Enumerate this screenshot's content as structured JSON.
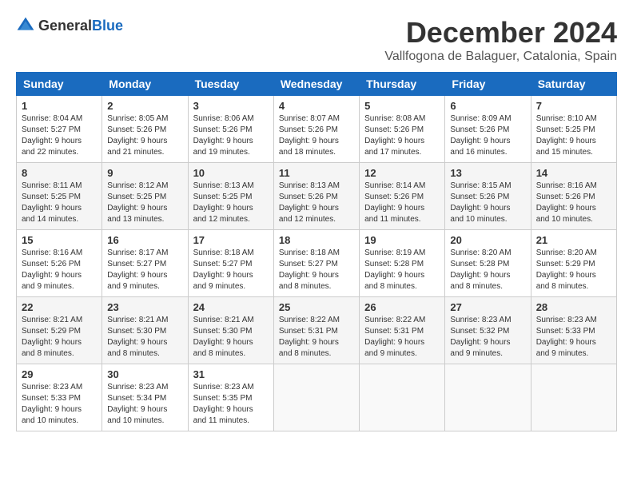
{
  "header": {
    "logo_general": "General",
    "logo_blue": "Blue",
    "month_title": "December 2024",
    "location": "Vallfogona de Balaguer, Catalonia, Spain"
  },
  "weekdays": [
    "Sunday",
    "Monday",
    "Tuesday",
    "Wednesday",
    "Thursday",
    "Friday",
    "Saturday"
  ],
  "weeks": [
    [
      {
        "day": "1",
        "sunrise": "8:04 AM",
        "sunset": "5:27 PM",
        "daylight": "9 hours and 22 minutes."
      },
      {
        "day": "2",
        "sunrise": "8:05 AM",
        "sunset": "5:26 PM",
        "daylight": "9 hours and 21 minutes."
      },
      {
        "day": "3",
        "sunrise": "8:06 AM",
        "sunset": "5:26 PM",
        "daylight": "9 hours and 19 minutes."
      },
      {
        "day": "4",
        "sunrise": "8:07 AM",
        "sunset": "5:26 PM",
        "daylight": "9 hours and 18 minutes."
      },
      {
        "day": "5",
        "sunrise": "8:08 AM",
        "sunset": "5:26 PM",
        "daylight": "9 hours and 17 minutes."
      },
      {
        "day": "6",
        "sunrise": "8:09 AM",
        "sunset": "5:26 PM",
        "daylight": "9 hours and 16 minutes."
      },
      {
        "day": "7",
        "sunrise": "8:10 AM",
        "sunset": "5:25 PM",
        "daylight": "9 hours and 15 minutes."
      }
    ],
    [
      {
        "day": "8",
        "sunrise": "8:11 AM",
        "sunset": "5:25 PM",
        "daylight": "9 hours and 14 minutes."
      },
      {
        "day": "9",
        "sunrise": "8:12 AM",
        "sunset": "5:25 PM",
        "daylight": "9 hours and 13 minutes."
      },
      {
        "day": "10",
        "sunrise": "8:13 AM",
        "sunset": "5:25 PM",
        "daylight": "9 hours and 12 minutes."
      },
      {
        "day": "11",
        "sunrise": "8:13 AM",
        "sunset": "5:26 PM",
        "daylight": "9 hours and 12 minutes."
      },
      {
        "day": "12",
        "sunrise": "8:14 AM",
        "sunset": "5:26 PM",
        "daylight": "9 hours and 11 minutes."
      },
      {
        "day": "13",
        "sunrise": "8:15 AM",
        "sunset": "5:26 PM",
        "daylight": "9 hours and 10 minutes."
      },
      {
        "day": "14",
        "sunrise": "8:16 AM",
        "sunset": "5:26 PM",
        "daylight": "9 hours and 10 minutes."
      }
    ],
    [
      {
        "day": "15",
        "sunrise": "8:16 AM",
        "sunset": "5:26 PM",
        "daylight": "9 hours and 9 minutes."
      },
      {
        "day": "16",
        "sunrise": "8:17 AM",
        "sunset": "5:27 PM",
        "daylight": "9 hours and 9 minutes."
      },
      {
        "day": "17",
        "sunrise": "8:18 AM",
        "sunset": "5:27 PM",
        "daylight": "9 hours and 9 minutes."
      },
      {
        "day": "18",
        "sunrise": "8:18 AM",
        "sunset": "5:27 PM",
        "daylight": "9 hours and 8 minutes."
      },
      {
        "day": "19",
        "sunrise": "8:19 AM",
        "sunset": "5:28 PM",
        "daylight": "9 hours and 8 minutes."
      },
      {
        "day": "20",
        "sunrise": "8:20 AM",
        "sunset": "5:28 PM",
        "daylight": "9 hours and 8 minutes."
      },
      {
        "day": "21",
        "sunrise": "8:20 AM",
        "sunset": "5:29 PM",
        "daylight": "9 hours and 8 minutes."
      }
    ],
    [
      {
        "day": "22",
        "sunrise": "8:21 AM",
        "sunset": "5:29 PM",
        "daylight": "9 hours and 8 minutes."
      },
      {
        "day": "23",
        "sunrise": "8:21 AM",
        "sunset": "5:30 PM",
        "daylight": "9 hours and 8 minutes."
      },
      {
        "day": "24",
        "sunrise": "8:21 AM",
        "sunset": "5:30 PM",
        "daylight": "9 hours and 8 minutes."
      },
      {
        "day": "25",
        "sunrise": "8:22 AM",
        "sunset": "5:31 PM",
        "daylight": "9 hours and 8 minutes."
      },
      {
        "day": "26",
        "sunrise": "8:22 AM",
        "sunset": "5:31 PM",
        "daylight": "9 hours and 9 minutes."
      },
      {
        "day": "27",
        "sunrise": "8:23 AM",
        "sunset": "5:32 PM",
        "daylight": "9 hours and 9 minutes."
      },
      {
        "day": "28",
        "sunrise": "8:23 AM",
        "sunset": "5:33 PM",
        "daylight": "9 hours and 9 minutes."
      }
    ],
    [
      {
        "day": "29",
        "sunrise": "8:23 AM",
        "sunset": "5:33 PM",
        "daylight": "9 hours and 10 minutes."
      },
      {
        "day": "30",
        "sunrise": "8:23 AM",
        "sunset": "5:34 PM",
        "daylight": "9 hours and 10 minutes."
      },
      {
        "day": "31",
        "sunrise": "8:23 AM",
        "sunset": "5:35 PM",
        "daylight": "9 hours and 11 minutes."
      },
      null,
      null,
      null,
      null
    ]
  ]
}
